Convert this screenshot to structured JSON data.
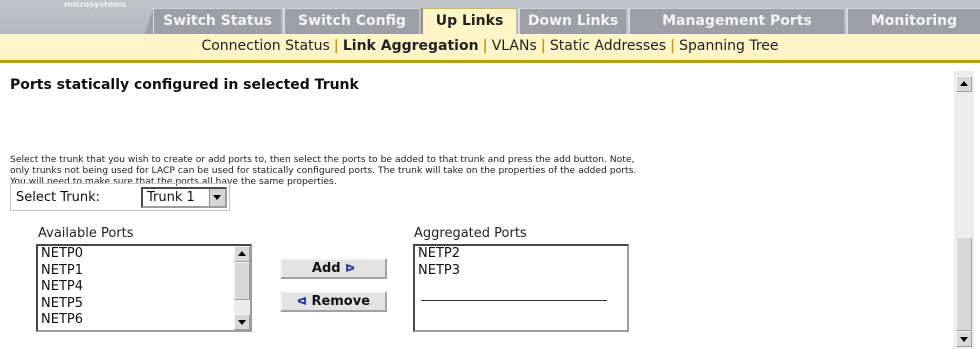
{
  "header": {
    "brand": "microsystems",
    "tabs": [
      {
        "label": "Switch Status",
        "active": false
      },
      {
        "label": "Switch Config",
        "active": false
      },
      {
        "label": "Up Links",
        "active": true
      },
      {
        "label": "Down Links",
        "active": false
      },
      {
        "label": "Management Ports",
        "active": false
      },
      {
        "label": "Monitoring",
        "active": false
      }
    ]
  },
  "subnav": {
    "items": [
      {
        "label": "Connection Status",
        "current": false
      },
      {
        "label": "Link Aggregation",
        "current": true
      },
      {
        "label": "VLANs",
        "current": false
      },
      {
        "label": "Static Addresses",
        "current": false
      },
      {
        "label": "Spanning Tree",
        "current": false
      }
    ],
    "separator": "|"
  },
  "main": {
    "section_title": "Ports statically configured in selected Trunk",
    "description_lines": [
      "Select the trunk that you wish to create or add ports to, then select the ports to be added to that trunk and press the add button. Note,",
      "only trunks not being used for LACP can be used for statically configured ports. The trunk will take on the properties of the added ports.",
      "You will need to make sure that the ports all have the same properties."
    ],
    "select_trunk": {
      "label": "Select Trunk:",
      "value": "Trunk 1"
    },
    "available_ports": {
      "label": "Available Ports",
      "items": [
        "NETP0",
        "NETP1",
        "NETP4",
        "NETP5",
        "NETP6"
      ]
    },
    "aggregated_ports": {
      "label": "Aggregated Ports",
      "items": [
        "NETP2",
        "NETP3"
      ]
    },
    "add_button": {
      "label": "Add",
      "glyph": "ᐅ"
    },
    "remove_button": {
      "label": "Remove",
      "glyph": "ᐊ"
    }
  },
  "colors": {
    "tab_inactive": "#9d9fa6",
    "tab_active": "#fff5c6",
    "subnav_bg": "#fff5c6",
    "subnav_border": "#b99b18"
  },
  "icons": {
    "scroll_up": "triangle-up-icon",
    "scroll_down": "triangle-down-icon",
    "dropdown": "chevron-down-icon"
  }
}
